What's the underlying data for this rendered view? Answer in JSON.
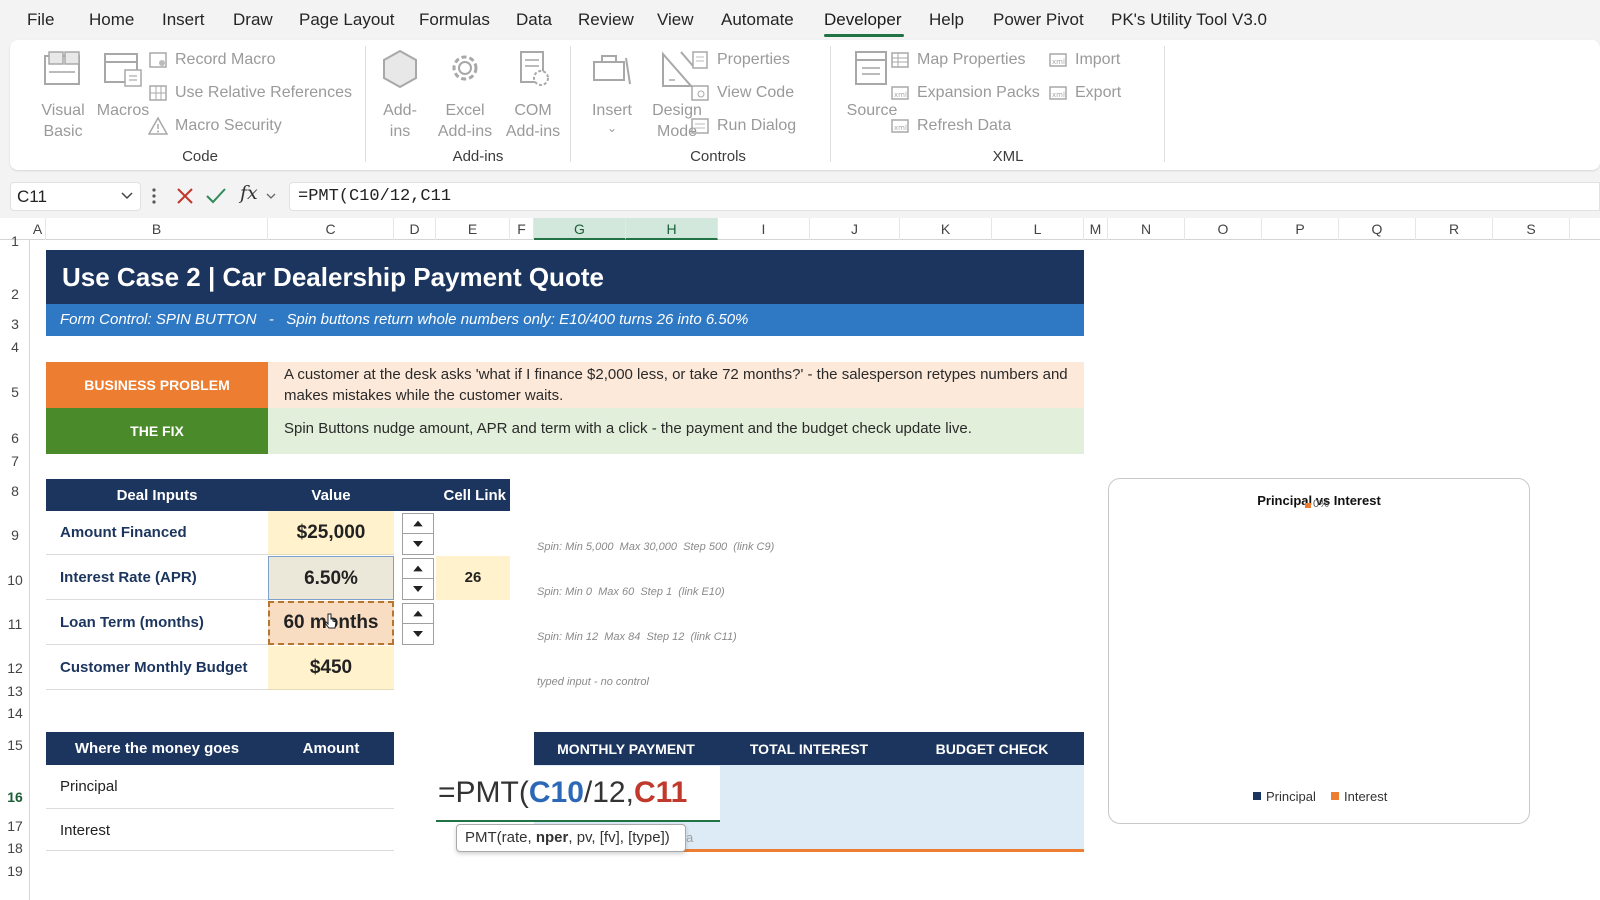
{
  "menu": [
    "File",
    "Home",
    "Insert",
    "Draw",
    "Page Layout",
    "Formulas",
    "Data",
    "Review",
    "View",
    "Automate",
    "Developer",
    "Help",
    "Power Pivot",
    "PK's Utility Tool V3.0"
  ],
  "ribbon": {
    "code": {
      "visual_basic": [
        "Visual",
        "Basic"
      ],
      "macros": "Macros",
      "record_macro": "Record Macro",
      "use_relative": "Use Relative References",
      "macro_security": "Macro Security",
      "label": "Code"
    },
    "addins": {
      "addins": [
        "Add-",
        "ins"
      ],
      "excel_addins": [
        "Excel",
        "Add-ins"
      ],
      "com_addins": [
        "COM",
        "Add-ins"
      ],
      "label": "Add-ins"
    },
    "controls": {
      "insert": "Insert",
      "design_mode": [
        "Design",
        "Mode"
      ],
      "properties": "Properties",
      "view_code": "View Code",
      "run_dialog": "Run Dialog",
      "label": "Controls"
    },
    "xml": {
      "source": "Source",
      "map_properties": "Map Properties",
      "expansion_packs": "Expansion Packs",
      "refresh_data": "Refresh Data",
      "import": "Import",
      "export": "Export",
      "label": "XML"
    }
  },
  "formula_bar": {
    "name_box": "C11",
    "formula": "=PMT(C10/12,C11",
    "fx": "fx"
  },
  "columns": [
    "A",
    "B",
    "C",
    "D",
    "E",
    "F",
    "G",
    "H",
    "I",
    "J",
    "K",
    "L",
    "M",
    "N",
    "O",
    "P",
    "Q",
    "R",
    "S"
  ],
  "rows": [
    "1",
    "2",
    "3",
    "4",
    "5",
    "6",
    "7",
    "8",
    "9",
    "10",
    "11",
    "12",
    "13",
    "14",
    "15",
    "16",
    "17",
    "18",
    "19"
  ],
  "sheet": {
    "title": "Use Case 2  |  Car Dealership Payment Quote",
    "subtitle": "Form Control: SPIN BUTTON   -   Spin buttons return whole numbers only: E10/400 turns 26 into 6.50%",
    "problem_tag": "BUSINESS PROBLEM",
    "problem_text": "A customer at the desk asks 'what if I finance $2,000 less, or take 72 months?' - the salesperson retypes numbers and makes mistakes while the customer waits.",
    "fix_tag": "THE FIX",
    "fix_text": "Spin Buttons nudge amount, APR and term with a click - the payment and the budget check update live.",
    "inputs_header": {
      "label": "Deal Inputs",
      "value": "Value",
      "link": "Cell Link"
    },
    "inputs": [
      {
        "label": "Amount Financed",
        "value": "$25,000",
        "note": "Spin: Min 5,000  Max 30,000  Step 500  (link C9)"
      },
      {
        "label": "Interest Rate (APR)",
        "value": "6.50%",
        "link": "26",
        "note": "Spin: Min 0  Max 60  Step 1  (link E10)"
      },
      {
        "label": "Loan Term (months)",
        "value": "60 months",
        "note": "Spin: Min 12  Max 84  Step 12  (link C11)"
      },
      {
        "label": "Customer Monthly Budget",
        "value": "$450",
        "note": "typed input - no control"
      }
    ],
    "money_header": {
      "label": "Where the money goes",
      "amount": "Amount"
    },
    "money_rows": [
      "Principal",
      "Interest"
    ],
    "kpi_headers": [
      "MONTHLY PAYMENT",
      "TOTAL INTEREST",
      "BUDGET CHECK"
    ],
    "edit_formula": {
      "prefix": "=PMT(",
      "ref1": "C10",
      "mid": "/12,",
      "ref2": "C11"
    },
    "tooltip": {
      "fn": "PMT(rate, ",
      "bold": "nper",
      "rest": ", pv, [fv], [type])",
      "tail": "a"
    }
  },
  "chart_data": {
    "type": "pie",
    "title": "Principal vs Interest",
    "data_label": "0%",
    "legend": [
      "Principal",
      "Interest"
    ],
    "legend_position": "bottom",
    "colors": {
      "principal": "#1c355e",
      "interest": "#ed7d31"
    },
    "values": []
  },
  "colors": {
    "navy": "#1c355e",
    "blue": "#2f78c3",
    "orange": "#ed7d31",
    "green": "#4a8a2a",
    "excel_green": "#217346"
  }
}
